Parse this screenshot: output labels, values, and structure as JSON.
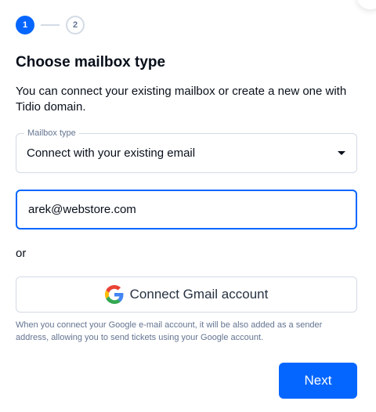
{
  "stepper": {
    "steps": [
      {
        "label": "1",
        "state": "active"
      },
      {
        "label": "2",
        "state": "inactive"
      }
    ]
  },
  "title": "Choose mailbox type",
  "description": "You can connect your existing mailbox or create a new one with Tidio domain.",
  "mailbox_type": {
    "label": "Mailbox type",
    "selected": "Connect with your existing email"
  },
  "email_field": {
    "value": "arek@webstore.com"
  },
  "or_text": "or",
  "gmail_button": {
    "label": "Connect Gmail account",
    "icon": "google-icon"
  },
  "note": "When you connect your Google e-mail account, it will be also added as a sender address, allowing you to send tickets using your Google account.",
  "next_button": "Next",
  "colors": {
    "accent": "#0566ff",
    "text": "#080f1a",
    "muted": "#647491",
    "border": "#d3dbe5"
  }
}
